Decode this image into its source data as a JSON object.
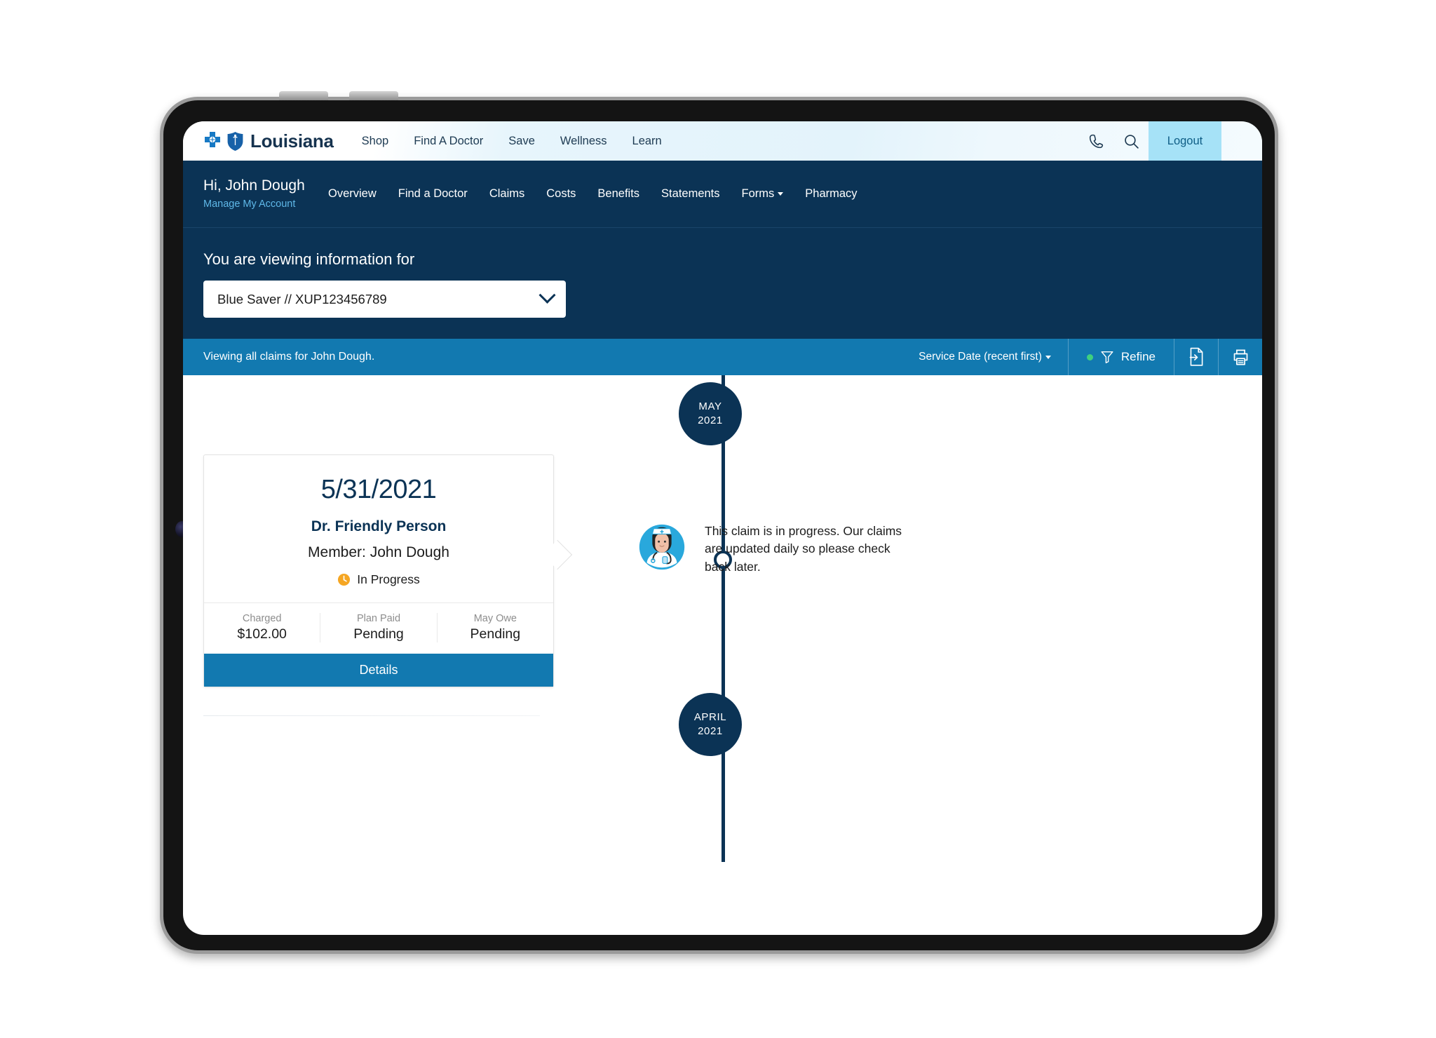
{
  "top_bar": {
    "brand": "Louisiana",
    "logo_icon": "blue-cross-blue-shield-logo",
    "nav": [
      {
        "label": "Shop"
      },
      {
        "label": "Find A Doctor"
      },
      {
        "label": "Save"
      },
      {
        "label": "Wellness"
      },
      {
        "label": "Learn"
      }
    ],
    "phone_icon": "phone-icon",
    "search_icon": "search-icon",
    "logout_label": "Logout"
  },
  "member_bar": {
    "greeting": "Hi, John Dough",
    "manage_account": "Manage My Account",
    "nav": [
      {
        "label": "Overview",
        "has_caret": false
      },
      {
        "label": "Find a Doctor",
        "has_caret": false
      },
      {
        "label": "Claims",
        "has_caret": false
      },
      {
        "label": "Costs",
        "has_caret": false
      },
      {
        "label": "Benefits",
        "has_caret": false
      },
      {
        "label": "Statements",
        "has_caret": false
      },
      {
        "label": "Forms",
        "has_caret": true
      },
      {
        "label": "Pharmacy",
        "has_caret": false
      }
    ]
  },
  "plan_section": {
    "title": "You are viewing information for",
    "selected_plan": "Blue Saver // XUP123456789",
    "chevron_icon": "chevron-down-icon"
  },
  "filter_bar": {
    "viewing_text": "Viewing all claims for John Dough.",
    "sort_label": "Service Date (recent first)",
    "sort_caret_icon": "caret-down-icon",
    "refine_label": "Refine",
    "refine_icon": "filter-funnel-icon",
    "refine_active_dot_color": "#3fd07e",
    "export_icon": "export-document-icon",
    "print_icon": "printer-icon"
  },
  "timeline": {
    "markers": [
      {
        "month": "MAY",
        "year": "2021"
      },
      {
        "month": "APRIL",
        "year": "2021"
      }
    ]
  },
  "claim": {
    "date": "5/31/2021",
    "provider": "Dr. Friendly Person",
    "member": "Member: John Dough",
    "status_label": "In Progress",
    "status_icon": "clock-icon",
    "status_color": "#f5a623",
    "amounts": [
      {
        "label": "Charged",
        "value": "$102.00"
      },
      {
        "label": "Plan Paid",
        "value": "Pending"
      },
      {
        "label": "May Owe",
        "value": "Pending"
      }
    ],
    "details_label": "Details",
    "message": "This claim is in progress. Our claims are updated daily so please check back later.",
    "message_avatar_icon": "nurse-avatar-icon"
  },
  "theme": {
    "navy": "#0b3355",
    "blue": "#1279b0",
    "light_blue": "#a6e2f7",
    "link_blue": "#5fb8e8"
  }
}
